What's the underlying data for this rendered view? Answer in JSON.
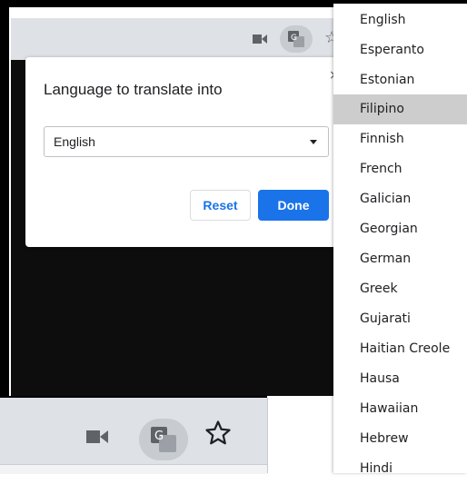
{
  "dialog": {
    "title": "Language to translate into",
    "selected_language": "English",
    "reset_label": "Reset",
    "done_label": "Done"
  },
  "language_list": {
    "items": [
      "English",
      "Esperanto",
      "Estonian",
      "Filipino",
      "Finnish",
      "French",
      "Galician",
      "Georgian",
      "German",
      "Greek",
      "Gujarati",
      "Haitian Creole",
      "Hausa",
      "Hawaiian",
      "Hebrew",
      "Hindi"
    ],
    "highlighted": "Filipino"
  },
  "toolbar": {
    "icons": [
      "video-camera-icon",
      "translate-icon",
      "bookmark-star-icon"
    ]
  },
  "colors": {
    "accent": "#1a73e8",
    "highlight": "#cdcdcd",
    "chrome": "#dee1e6",
    "page_background": "#0d0d0d"
  }
}
